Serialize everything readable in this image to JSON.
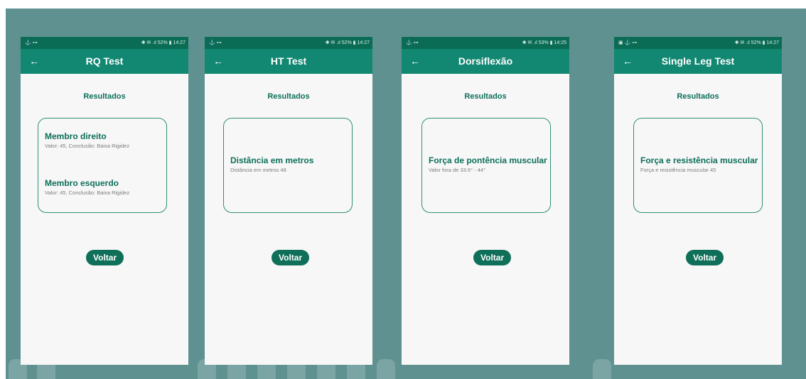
{
  "colors": {
    "background": "#5f9190",
    "statusbar": "#0b6c55",
    "appbar": "#128872",
    "accent_text": "#0d6f5a",
    "button": "#0f6f58"
  },
  "icons": {
    "back": "arrow-left-icon"
  },
  "screens": [
    {
      "status_left": "⚓ ⊶",
      "status_right": "✱ ✉ .ıl 52% ▮ 14:27",
      "title": "RQ Test",
      "results_label": "Resultados",
      "entries": [
        {
          "title": "Membro direito",
          "value": "Valor: 45,  Conclusão: Baixa Rigidez"
        },
        {
          "title": "Membro esquerdo",
          "value": "Valor: 45,  Conclusão: Baixa Rigidez"
        }
      ],
      "button": "Voltar"
    },
    {
      "status_left": "⚓ ⊶",
      "status_right": "✱ ✉ .ıl 52% ▮ 14:27",
      "title": "HT Test",
      "results_label": "Resultados",
      "entries": [
        {
          "title": "Distância em metros",
          "value": "Distância em metros 48"
        }
      ],
      "button": "Voltar"
    },
    {
      "status_left": "⚓ ⊶",
      "status_right": "✱ ✉ .ıl 53% ▮ 14:25",
      "title": "Dorsiflexão",
      "results_label": "Resultados",
      "entries": [
        {
          "title": "Força de pontência muscular",
          "value": "Valor fora de 33.6° - 44°"
        }
      ],
      "button": "Voltar"
    },
    {
      "status_left": "▣ ⚓ ⊶",
      "status_right": "✱ ✉ .ıl 52% ▮ 14:27",
      "title": "Single Leg Test",
      "results_label": "Resultados",
      "entries": [
        {
          "title": "Força e resistência muscular",
          "value": "Força e resistência muscular 45"
        }
      ],
      "button": "Voltar"
    }
  ]
}
